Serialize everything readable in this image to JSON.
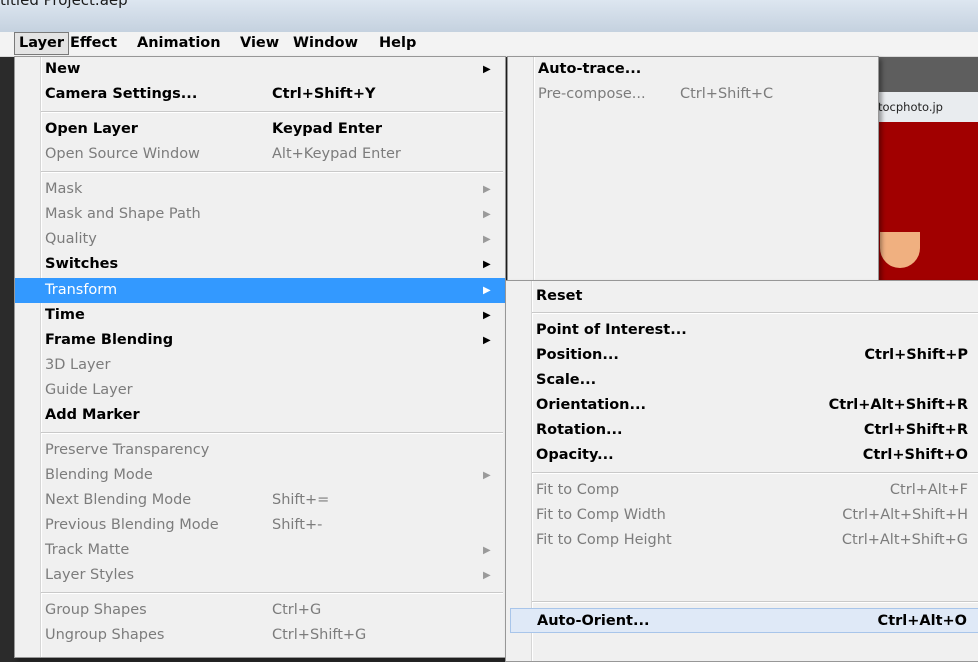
{
  "window": {
    "title": "titled Project.aep"
  },
  "menubar": [
    "Layer",
    "Effect",
    "Animation",
    "View",
    "Window",
    "Help"
  ],
  "layer_menu": [
    {
      "label": "New",
      "submenu": true
    },
    {
      "label": "Camera Settings...",
      "shortcut": "Ctrl+Shift+Y"
    },
    {
      "label": "Open Layer",
      "shortcut": "Keypad Enter"
    },
    {
      "label": "Open Source Window",
      "shortcut": "Alt+Keypad Enter",
      "disabled": true
    },
    {
      "label": "Mask",
      "submenu": true,
      "disabled": true
    },
    {
      "label": "Mask and Shape Path",
      "submenu": true,
      "disabled": true
    },
    {
      "label": "Quality",
      "submenu": true,
      "disabled": true
    },
    {
      "label": "Switches",
      "submenu": true
    },
    {
      "label": "Transform",
      "submenu": true,
      "highlighted": true
    },
    {
      "label": "Time",
      "submenu": true
    },
    {
      "label": "Frame Blending",
      "submenu": true
    },
    {
      "label": "3D Layer",
      "disabled": true
    },
    {
      "label": "Guide Layer",
      "disabled": true
    },
    {
      "label": "Add Marker"
    },
    {
      "label": "Preserve Transparency",
      "disabled": true
    },
    {
      "label": "Blending Mode",
      "submenu": true,
      "disabled": true
    },
    {
      "label": "Next Blending Mode",
      "shortcut": "Shift+=",
      "disabled": true
    },
    {
      "label": "Previous Blending Mode",
      "shortcut": "Shift+-",
      "disabled": true
    },
    {
      "label": "Track Matte",
      "submenu": true,
      "disabled": true
    },
    {
      "label": "Layer Styles",
      "submenu": true,
      "disabled": true
    },
    {
      "label": "Group Shapes",
      "shortcut": "Ctrl+G",
      "disabled": true
    },
    {
      "label": "Ungroup Shapes",
      "shortcut": "Ctrl+Shift+G",
      "disabled": true
    }
  ],
  "new_submenu": [
    {
      "label": "Auto-trace..."
    },
    {
      "label": "Pre-compose...",
      "shortcut": "Ctrl+Shift+C",
      "disabled": true
    }
  ],
  "transform_submenu": [
    {
      "label": "Reset"
    },
    {
      "label": "Point of Interest..."
    },
    {
      "label": "Position...",
      "shortcut": "Ctrl+Shift+P"
    },
    {
      "label": "Scale..."
    },
    {
      "label": "Orientation...",
      "shortcut": "Ctrl+Alt+Shift+R"
    },
    {
      "label": "Rotation...",
      "shortcut": "Ctrl+Shift+R"
    },
    {
      "label": "Opacity...",
      "shortcut": "Ctrl+Shift+O"
    },
    {
      "label": "Fit to Comp",
      "shortcut": "Ctrl+Alt+F",
      "disabled": true
    },
    {
      "label": "Fit to Comp Width",
      "shortcut": "Ctrl+Alt+Shift+H",
      "disabled": true
    },
    {
      "label": "Fit to Comp Height",
      "shortcut": "Ctrl+Alt+Shift+G",
      "disabled": true
    },
    {
      "label": "Auto-Orient...",
      "shortcut": "Ctrl+Alt+O",
      "boxed": true
    }
  ],
  "background": {
    "tab_label": "tocphoto.jp"
  },
  "colors": {
    "highlight": "#3399ff",
    "menu_bg": "#f0f0f0",
    "disabled_text": "#7c7c7c"
  }
}
